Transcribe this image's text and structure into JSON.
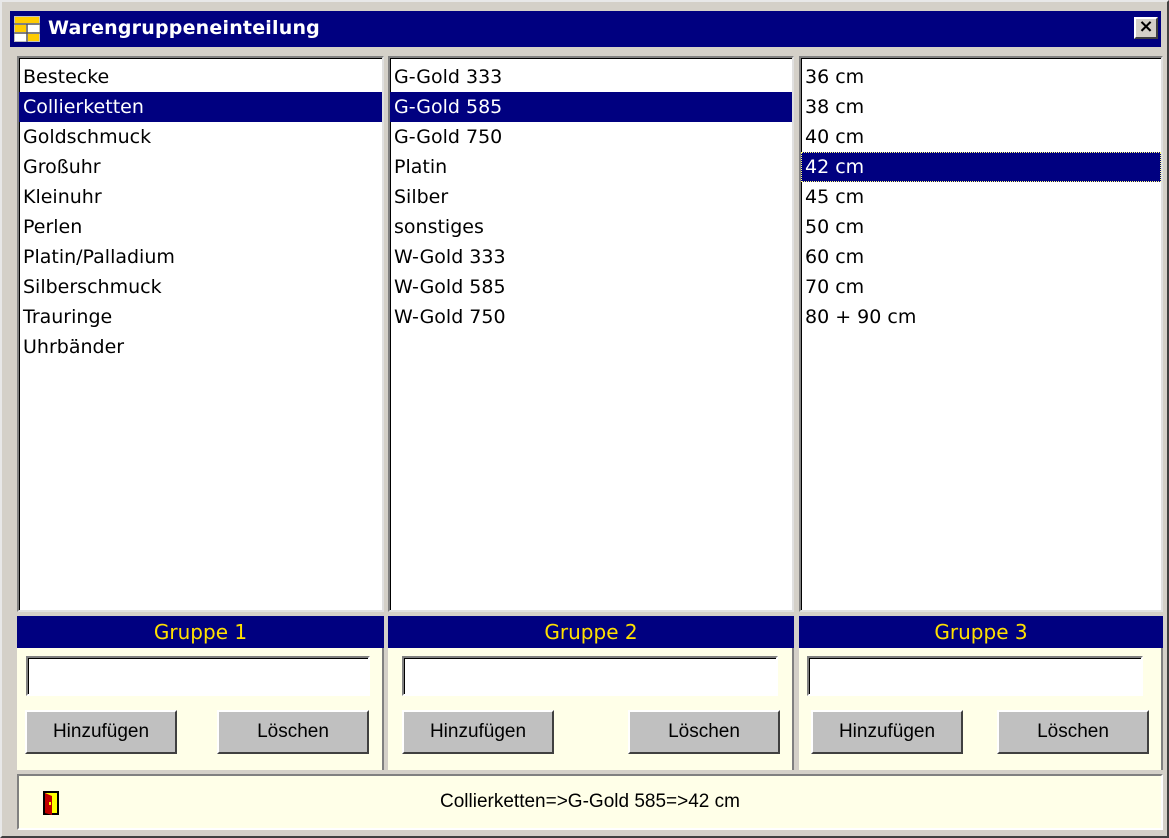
{
  "window": {
    "title": "Warengruppeneinteilung",
    "close_label": "×"
  },
  "group1": {
    "header": "Gruppe 1",
    "items": [
      "Bestecke",
      "Collierketten",
      "Goldschmuck",
      "Großuhr",
      "Kleinuhr",
      "Perlen",
      "Platin/Palladium",
      "Silberschmuck",
      "Trauringe",
      "Uhrbänder"
    ],
    "selected": "Collierketten",
    "input_value": "",
    "add_label": "Hinzufügen",
    "delete_label": "Löschen"
  },
  "group2": {
    "header": "Gruppe 2",
    "items": [
      "G-Gold 333",
      "G-Gold 585",
      "G-Gold 750",
      "Platin",
      "Silber",
      "sonstiges",
      "W-Gold 333",
      "W-Gold 585",
      "W-Gold 750"
    ],
    "selected": "G-Gold 585",
    "input_value": "",
    "add_label": "Hinzufügen",
    "delete_label": "Löschen"
  },
  "group3": {
    "header": "Gruppe 3",
    "items": [
      "36 cm",
      "38 cm",
      "40 cm",
      "42 cm",
      "45 cm",
      "50 cm",
      "60 cm",
      "70 cm",
      "80 + 90 cm"
    ],
    "selected": "42 cm",
    "input_value": "",
    "add_label": "Hinzufügen",
    "delete_label": "Löschen"
  },
  "status": {
    "path_text": "Collierketten=>G-Gold 585=>42 cm",
    "exit_icon": "exit-door-icon"
  },
  "colors": {
    "titlebar": "#000080",
    "selection": "#000080",
    "group_header_text": "#ffe000",
    "panel_bg": "#ffffe8",
    "window_bg": "#d4d0c8"
  }
}
